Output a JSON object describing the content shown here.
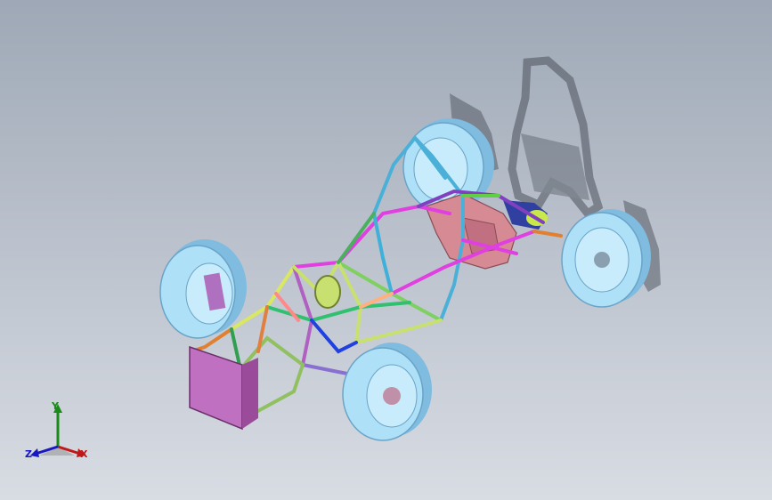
{
  "viewport": {
    "description_mode": "3d-model-view",
    "colors": {
      "tire": "#aee0f7",
      "tire_dark": "#78b8dc",
      "engine": "#d58a94",
      "shadow": "#606670",
      "firewall": "#c070c0"
    }
  },
  "triad": {
    "x_label": "X",
    "y_label": "Y",
    "z_label": "Z",
    "colors": {
      "x": "#c01818",
      "y": "#1a8a1a",
      "z": "#1818c0"
    }
  }
}
